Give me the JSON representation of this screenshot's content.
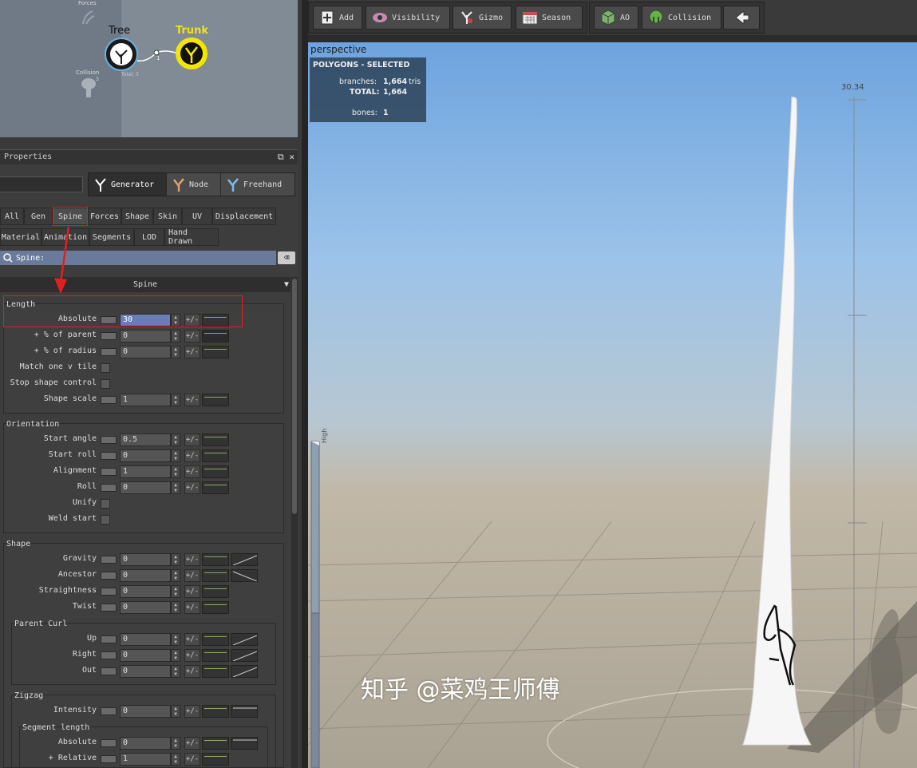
{
  "node_graph": {
    "forces_label": "Forces",
    "tree_label": "Tree",
    "trunk_label": "Trunk",
    "collision_label": "Collision",
    "total_label": "Total: 3",
    "link_count": "1",
    "collision_count": "3"
  },
  "properties": {
    "title": "Properties",
    "modes": [
      {
        "label": "Generator",
        "icon": "generator-icon"
      },
      {
        "label": "Node",
        "icon": "node-icon"
      },
      {
        "label": "Freehand",
        "icon": "freehand-icon"
      }
    ],
    "tabs_row1": [
      "All",
      "Gen",
      "Spine",
      "Forces",
      "Shape",
      "Skin",
      "UV",
      "Displacement"
    ],
    "tabs_row2": [
      "Material",
      "Animation",
      "Segments",
      "LOD",
      "Hand Drawn"
    ],
    "active_tab": "Spine",
    "search_value": "Spine:",
    "section_title": "Spine",
    "groups": {
      "length": "Length",
      "orientation": "Orientation",
      "shape": "Shape",
      "parent_curl": "Parent Curl",
      "zigzag": "Zigzag",
      "segment_length": "Segment length"
    },
    "pm_label": "+/-",
    "length_rows": [
      {
        "label": "Absolute",
        "value": "30"
      },
      {
        "label": "+ % of parent",
        "value": "0"
      },
      {
        "label": "+ % of radius",
        "value": "0"
      }
    ],
    "length_checks": [
      "Match one v tile",
      "Stop shape control"
    ],
    "shape_scale": {
      "label": "Shape scale",
      "value": "1"
    },
    "orientation_rows": [
      {
        "label": "Start angle",
        "value": "0.5"
      },
      {
        "label": "Start roll",
        "value": "0"
      },
      {
        "label": "Alignment",
        "value": "1"
      },
      {
        "label": "Roll",
        "value": "0"
      }
    ],
    "orientation_checks": [
      "Unify",
      "Weld start"
    ],
    "shape_rows": [
      {
        "label": "Gravity",
        "value": "0"
      },
      {
        "label": "Ancestor",
        "value": "0"
      },
      {
        "label": "Straightness",
        "value": "0"
      },
      {
        "label": "Twist",
        "value": "0"
      }
    ],
    "curl_rows": [
      {
        "label": "Up",
        "value": "0"
      },
      {
        "label": "Right",
        "value": "0"
      },
      {
        "label": "Out",
        "value": "0"
      }
    ],
    "zigzag_rows": [
      {
        "label": "Intensity",
        "value": "0"
      }
    ],
    "segment_rows": [
      {
        "label": "Absolute",
        "value": "0"
      },
      {
        "label": "+ Relative",
        "value": "1"
      }
    ]
  },
  "toolbar": {
    "add": "Add",
    "visibility": "Visibility",
    "gizmo": "Gizmo",
    "season": "Season",
    "ao": "AO",
    "collision": "Collision"
  },
  "viewport": {
    "label": "perspective",
    "stats_title": "POLYGONS - SELECTED",
    "branches_label": "branches:",
    "branches_value": "1,664",
    "branches_unit": "tris",
    "total_label": "TOTAL:",
    "total_value": "1,664",
    "bones_label": "bones:",
    "bones_value": "1",
    "scale_value": "30.34",
    "slider_label": "High"
  },
  "watermark": "知乎 @菜鸡王师傅"
}
